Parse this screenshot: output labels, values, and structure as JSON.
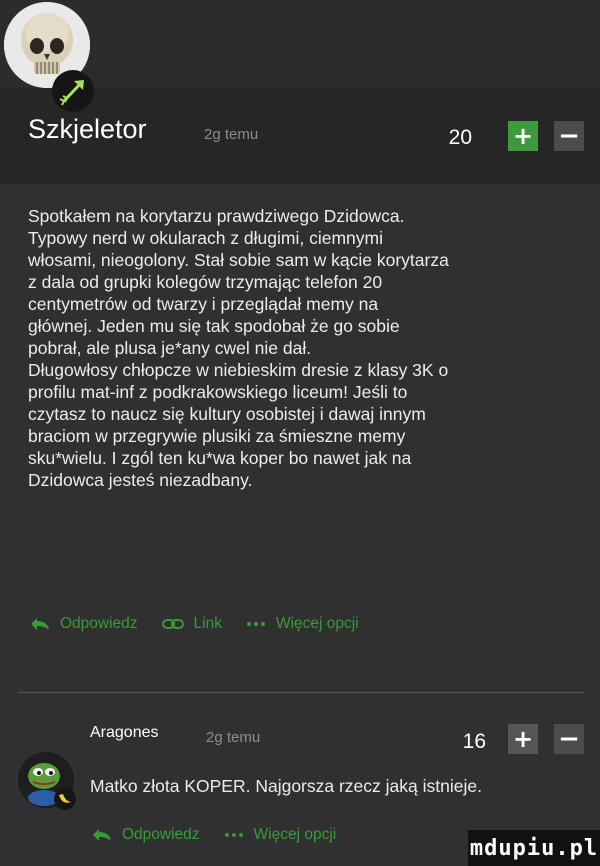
{
  "comment": {
    "username": "Szkjeletor",
    "time": "2g temu",
    "score": "20",
    "vote_plus": "+",
    "vote_minus": "−",
    "lines": [
      "Spotkałem na korytarzu prawdziwego Dzidowca.",
      "Typowy nerd w okularach z długimi, ciemnymi",
      "włosami, nieogolony. Stał sobie sam w kącie korytarza",
      "z dala od grupki kolegów trzymając telefon 20",
      "centymetrów od twarzy i przeglądał memy na",
      "głównej. Jeden mu się tak spodobał że go sobie",
      "pobrał, ale plusa je*any cwel nie dał.",
      "Długowłosy chłopcze w niebieskim dresie z klasy 3K o",
      "profilu mat-inf z podkrakowskiego liceum! Jeśli to",
      "czytasz to naucz się kultury osobistej i dawaj innym",
      "braciom w przegrywie plusiki za śmieszne memy",
      "sku*wielu. I zgól ten ku*wa koper bo nawet jak na",
      "Dzidowca jesteś niezadbany."
    ],
    "actions": {
      "reply": "Odpowiedz",
      "link": "Link",
      "more": "Więcej opcji"
    },
    "icons": [
      "reply-arrow-icon",
      "link-chain-icon",
      "more-dots-icon"
    ]
  },
  "reply": {
    "username": "Aragones",
    "time": "2g temu",
    "score": "16",
    "vote_plus": "+",
    "vote_minus": "−",
    "text": "Matko złota KOPER. Najgorsza rzecz jaką istnieje.",
    "actions": {
      "reply": "Odpowiedz",
      "more": "Więcej opcji"
    }
  },
  "watermark": "mdupiu.pl",
  "colors": {
    "background": "#303030",
    "header_band": "#262626",
    "accent_green": "#3a9a38",
    "text": "#ececec",
    "muted": "#8d8d8d"
  }
}
